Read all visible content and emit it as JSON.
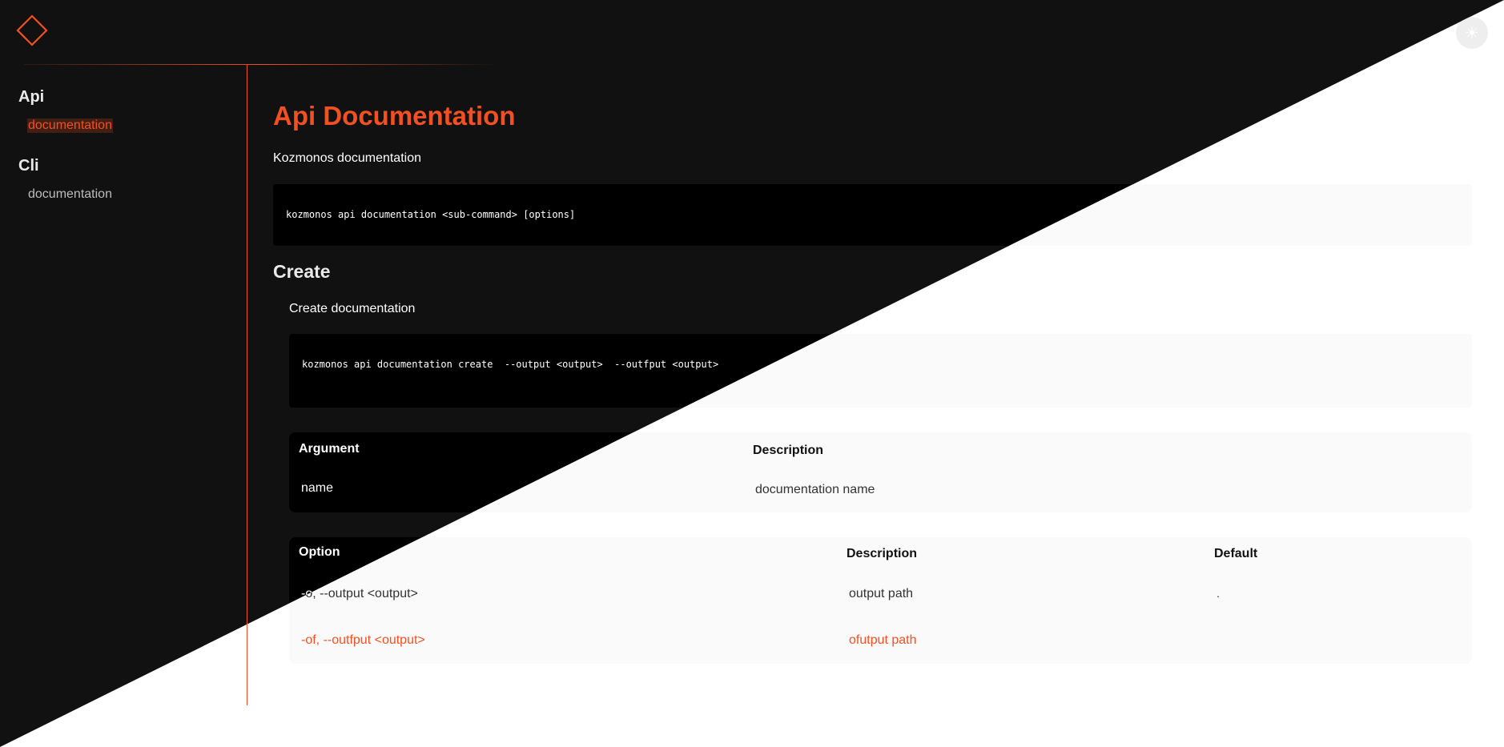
{
  "header": {
    "logo": "diamond-logo-icon",
    "theme_toggle_icon": "sun-icon"
  },
  "sidebar": {
    "groups": [
      {
        "title": "Api",
        "items": [
          {
            "label": "documentation",
            "active": true
          }
        ]
      },
      {
        "title": "Cli",
        "items": [
          {
            "label": "documentation",
            "active": false
          }
        ]
      }
    ]
  },
  "main": {
    "title": "Api Documentation",
    "description": "Kozmonos documentation",
    "usage": "kozmonos api documentation <sub-command> [options]",
    "sections": [
      {
        "title": "Create",
        "description": "Create documentation",
        "usage": "kozmonos api documentation create  --output <output>  --outfput <output>",
        "arguments": {
          "headers": [
            "Argument",
            "Description"
          ],
          "rows": [
            [
              "name",
              "documentation name"
            ]
          ]
        },
        "options": {
          "headers": [
            "Option",
            "Description",
            "Default"
          ],
          "rows": [
            [
              "-o, --output <output>",
              "output path",
              "."
            ],
            [
              "-of, --outfput <output>",
              "ofutput path",
              ""
            ]
          ]
        }
      }
    ]
  },
  "colors": {
    "accent": "#f25022",
    "dark_bg": "#111111",
    "light_bg": "#ffffff",
    "code_dark": "#000000",
    "code_light": "#fafafa"
  }
}
